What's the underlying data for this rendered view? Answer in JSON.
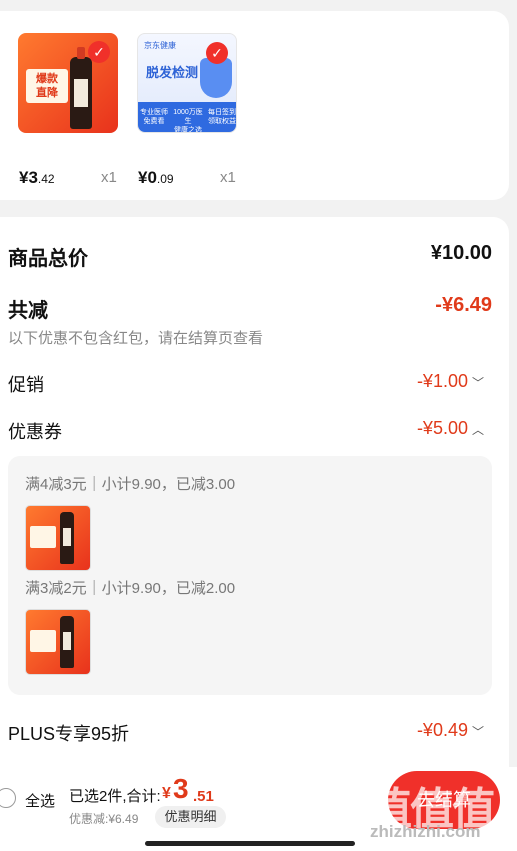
{
  "products": [
    {
      "price_yuan": "¥3",
      "price_cents": ".42",
      "qty": "x1",
      "badge": "爆款\n直降"
    },
    {
      "price_yuan": "¥0",
      "price_cents": ".09",
      "qty": "x1",
      "title": "脱发检测",
      "logo": "京东健康",
      "band": [
        "专业医师\n免费看",
        "1000万医生\n健康之选",
        "每日签到\n领取权益"
      ]
    }
  ],
  "summary": {
    "goods_total_label": "商品总价",
    "goods_total_value": "¥10.00",
    "reduce_label": "共减",
    "reduce_value": "-¥6.49",
    "note": "以下优惠不包含红包，请在结算页查看",
    "promo_label": "促销",
    "promo_value": "-¥1.00",
    "coupon_label": "优惠券",
    "coupon_value": "-¥5.00",
    "plus_label": "PLUS专享95折",
    "plus_value": "-¥0.49"
  },
  "coupons": [
    {
      "text": "满4减3元｜小计9.90，已减3.00"
    },
    {
      "text": "满3减2元｜小计9.90，已减2.00"
    }
  ],
  "bottom": {
    "select_all": "全选",
    "selected_summary": "已选2件,合计:",
    "total_symbol": "¥",
    "total_int": "3",
    "total_dec": ".51",
    "discount_note": "优惠减:¥6.49",
    "detail_button": "优惠明细",
    "checkout": "去结算"
  },
  "watermark": {
    "text": "值值值",
    "site": "zhizhizhi.com"
  },
  "colors": {
    "accent": "#f0302a",
    "price_red": "#e03a1a"
  }
}
